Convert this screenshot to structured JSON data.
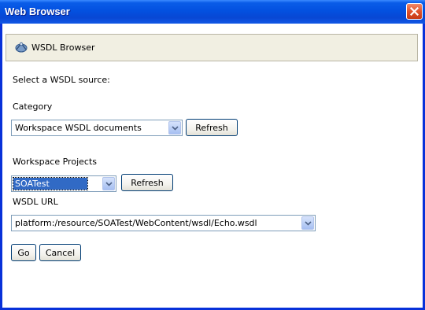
{
  "window": {
    "title": "Web Browser"
  },
  "header": {
    "title": "WSDL Browser",
    "icon": "wsdl-browser-icon"
  },
  "form": {
    "prompt": "Select a WSDL source:",
    "category_label": "Category",
    "category_value": "Workspace WSDL documents",
    "category_refresh": "Refresh",
    "projects_label": "Workspace Projects",
    "projects_value": "SOATest",
    "projects_refresh": "Refresh",
    "url_label": "WSDL URL",
    "url_value": "platform:/resource/SOATest/WebContent/wsdl/Echo.wsdl",
    "go_label": "Go",
    "cancel_label": "Cancel"
  },
  "colors": {
    "titlebar": "#0a5ce8",
    "close_button": "#e0522c",
    "selection": "#316ac5",
    "window_border": "#0831d9"
  }
}
